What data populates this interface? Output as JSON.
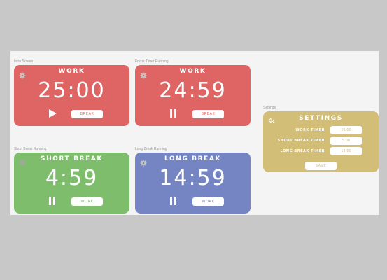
{
  "colors": {
    "work": "#df6565",
    "short_break": "#7dbd6c",
    "long_break": "#7584c2",
    "settings": "#d3be78",
    "canvas": "#f4f4f4",
    "desktop": "#c8c8c8"
  },
  "frames": {
    "intro": {
      "label": "Intro Screen",
      "title": "WORK",
      "time": "25:00",
      "control_icon": "play-icon",
      "switch_label": "BREAK"
    },
    "focus": {
      "label": "Focus Timer Running",
      "title": "WORK",
      "time": "24:59",
      "control_icon": "pause-icon",
      "switch_label": "BREAK"
    },
    "short": {
      "label": "Short Break Running",
      "title": "SHORT BREAK",
      "time": "4:59",
      "control_icon": "pause-icon",
      "switch_label": "WORK"
    },
    "long": {
      "label": "Long Break Running",
      "title": "LONG BREAK",
      "time": "14:59",
      "control_icon": "pause-icon",
      "switch_label": "WORK"
    },
    "settings": {
      "label": "Settings",
      "title": "SETTINGS",
      "rows": [
        {
          "label": "WORK TIMER",
          "value": "25:00"
        },
        {
          "label": "SHORT BREAK TIMER",
          "value": "5:00"
        },
        {
          "label": "LONG BREAK TIMER",
          "value": "15:00"
        }
      ],
      "save_label": "SAVE"
    }
  }
}
